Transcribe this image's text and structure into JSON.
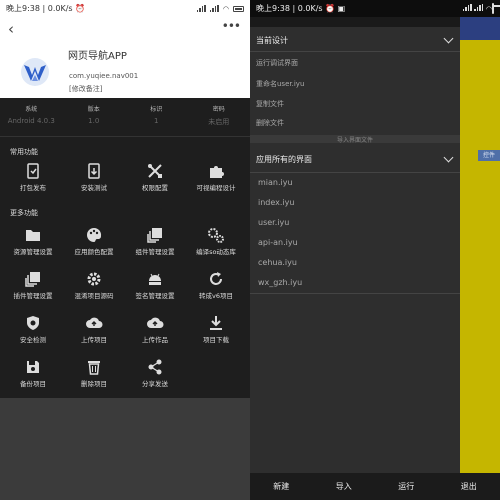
{
  "colors": {
    "left_bg": "#1e1e1e",
    "right_drawer": "#2e2e2e",
    "accent_yellow": "#c5b600",
    "accent_blue": "#2c3f80"
  },
  "left": {
    "status": {
      "time": "晚上9:38",
      "speed": "0.0K/s"
    },
    "app": {
      "name": "网页导航APP",
      "package": "com.yuqiee.nav001",
      "note": "[修改备注]"
    },
    "meta": [
      {
        "label": "系统",
        "value": "Android 4.0.3"
      },
      {
        "label": "版本",
        "value": "1.0"
      },
      {
        "label": "标识",
        "value": "1"
      },
      {
        "label": "密码",
        "value": "未启用"
      }
    ],
    "common_title": "常用功能",
    "common": [
      {
        "label": "打包发布",
        "icon": "package-icon"
      },
      {
        "label": "安装测试",
        "icon": "install-icon"
      },
      {
        "label": "权限配置",
        "icon": "tools-icon"
      },
      {
        "label": "可视编程设计",
        "icon": "puzzle-icon"
      }
    ],
    "more_title": "更多功能",
    "more": [
      {
        "label": "资源管理设置",
        "icon": "folder-icon"
      },
      {
        "label": "应用颜色配置",
        "icon": "palette-icon"
      },
      {
        "label": "组件管理设置",
        "icon": "layers-icon"
      },
      {
        "label": "编译so动态库",
        "icon": "cogs-icon"
      },
      {
        "label": "插件管理设置",
        "icon": "layers-icon"
      },
      {
        "label": "混淆项目源码",
        "icon": "gear-icon"
      },
      {
        "label": "签名管理设置",
        "icon": "android-icon"
      },
      {
        "label": "转成v6项目",
        "icon": "refresh-icon"
      },
      {
        "label": "安全检测",
        "icon": "shield-icon"
      },
      {
        "label": "上传项目",
        "icon": "cloud-upload-icon"
      },
      {
        "label": "上传作品",
        "icon": "cloud-upload-icon"
      },
      {
        "label": "项目下载",
        "icon": "download-icon"
      },
      {
        "label": "备份项目",
        "icon": "save-icon"
      },
      {
        "label": "删除项目",
        "icon": "trash-icon"
      },
      {
        "label": "分享发送",
        "icon": "share-icon"
      }
    ]
  },
  "right": {
    "status": {
      "time": "晚上9:38",
      "speed": "0.0K/s"
    },
    "side_chip": "控件",
    "current_title": "当前设计",
    "current_options": [
      "运行调试界面",
      "重命名user.iyu",
      "复制文件",
      "删除文件"
    ],
    "import_hint": "导入界面文件",
    "all_title": "应用所有的界面",
    "files": [
      "mian.iyu",
      "index.iyu",
      "user.iyu",
      "api-an.iyu",
      "cehua.iyu",
      "wx_gzh.iyu"
    ],
    "bottom": [
      "新建",
      "导入",
      "运行",
      "退出"
    ]
  }
}
